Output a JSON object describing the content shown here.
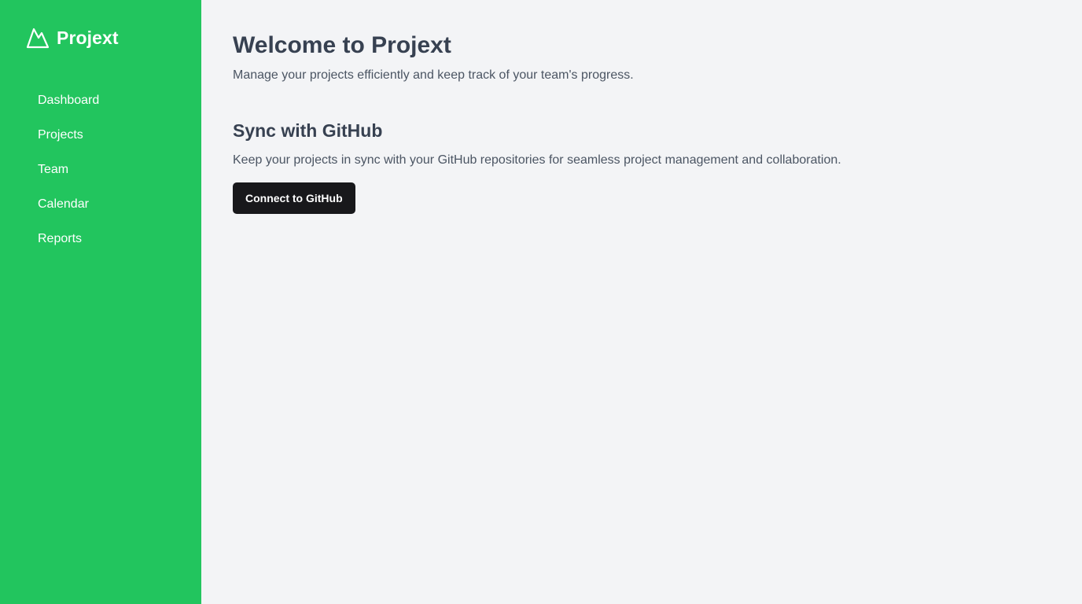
{
  "app": {
    "name": "Projext",
    "logo_icon": "mountain-icon",
    "accent_color": "#22c55e"
  },
  "sidebar": {
    "items": [
      {
        "label": "Dashboard"
      },
      {
        "label": "Projects"
      },
      {
        "label": "Team"
      },
      {
        "label": "Calendar"
      },
      {
        "label": "Reports"
      }
    ]
  },
  "main": {
    "title": "Welcome to Projext",
    "subtitle": "Manage your projects efficiently and keep track of your team's progress.",
    "github_section": {
      "title": "Sync with GitHub",
      "description": "Keep your projects in sync with your GitHub repositories for seamless project management and collaboration.",
      "button_label": "Connect to GitHub",
      "button_color": "#18181b"
    }
  }
}
